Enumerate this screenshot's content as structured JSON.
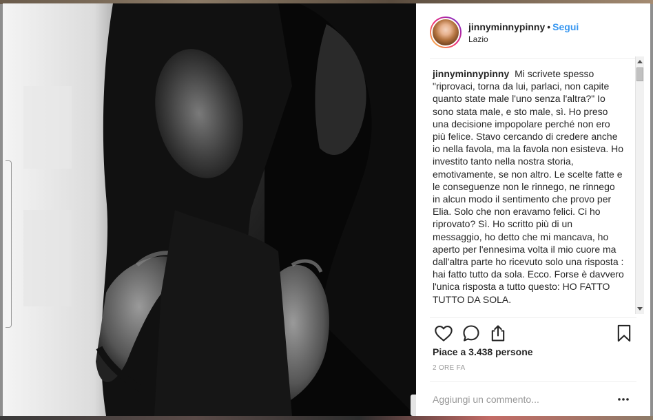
{
  "post": {
    "username": "jinnyminnypinny",
    "follow_label": "Segui",
    "separator": "•",
    "location": "Lazio",
    "caption": "Mi scrivete spesso \"riprovaci, torna da lui, parlaci, non capite quanto state male l'uno senza l'altra?\" Io sono stata male, e sto male, sì. Ho preso una decisione impopolare perché non ero più felice. Stavo cercando di credere anche io nella favola, ma la favola non esisteva. Ho investito tanto nella nostra storia, emotivamente, se non altro. Le scelte fatte e le conseguenze non le rinnego, ne rinnego in alcun modo il sentimento che provo per Elia. Solo che non eravamo felici. Ci ho riprovato? Sì. Ho scritto più di un messaggio, ho detto che mi mancava, ho aperto per l'ennesima volta il mio cuore ma dall'altra parte ho ricevuto solo una risposta : hai fatto tutto da sola. Ecco. Forse è davvero l'unica risposta a tutto questo: HO FATTO TUTTO DA SOLA.",
    "likes_text": "Piace a 3.438 persone",
    "timestamp": "2 ORE FA"
  },
  "comment": {
    "placeholder": "Aggiungi un commento..."
  },
  "icons": {
    "like": "heart-icon",
    "comment": "comment-bubble-icon",
    "share": "share-icon",
    "save": "bookmark-icon",
    "more": "more-options-icon"
  },
  "colors": {
    "link_blue": "#3897f0",
    "text": "#262626",
    "muted": "#999999"
  }
}
